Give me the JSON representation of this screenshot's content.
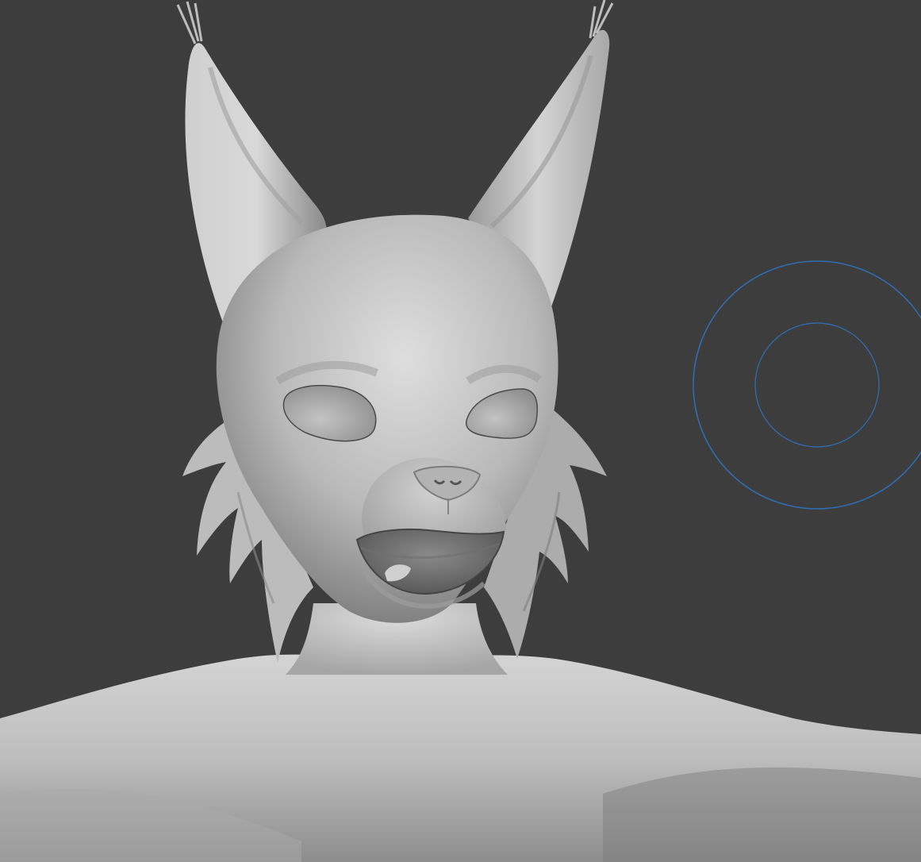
{
  "viewport": {
    "background_color": "#3d3d3d",
    "mode": "sculpt"
  },
  "model": {
    "subject": "lynx-head-bust-sculpt",
    "material_color": "#bfbfbf",
    "shadow_color": "#6f6f6f",
    "highlight_color": "#e4e4e4"
  },
  "brush_cursor": {
    "icon": "brush-radius-icon",
    "color": "#2f6fb8"
  }
}
